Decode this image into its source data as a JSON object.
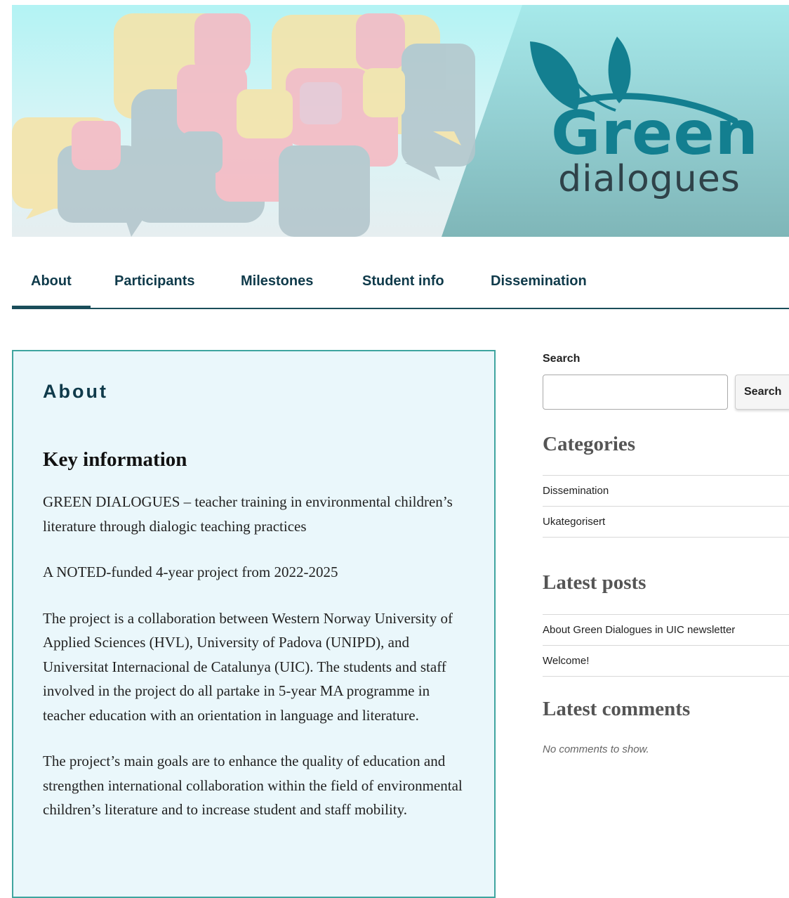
{
  "banner": {
    "wordmark_line1": "Green",
    "wordmark_line2": "dialogues",
    "colors": {
      "teal": "#137f90",
      "dark": "#2f4249",
      "sky": "#b6f2f4"
    }
  },
  "nav": {
    "items": [
      {
        "label": "About",
        "active": true
      },
      {
        "label": "Participants"
      },
      {
        "label": "Milestones"
      },
      {
        "label": "Student info"
      },
      {
        "label": "Dissemination"
      }
    ]
  },
  "main": {
    "page_title": "About",
    "section_heading": "Key information",
    "paragraphs": [
      "GREEN DIALOGUES – teacher training in environmental children’s literature through dialogic teaching practices",
      "A NOTED-funded 4-year project from 2022-2025",
      "The project is a collaboration between Western Norway University of Applied Sciences (HVL), University of Padova (UNIPD), and Universitat Internacional de Catalunya (UIC). The students and staff involved in the project do all partake in 5-year MA programme in teacher education with an orientation in language and literature.",
      "The project’s main goals are to enhance the quality of education and strengthen international collaboration within the field of environmental children’s literature and to increase student and staff mobility."
    ]
  },
  "sidebar": {
    "search": {
      "label": "Search",
      "button_label": "Search",
      "value": "",
      "placeholder": ""
    },
    "categories": {
      "title": "Categories",
      "items": [
        "Dissemination",
        "Ukategorisert"
      ]
    },
    "latest_posts": {
      "title": "Latest posts",
      "items": [
        "About Green Dialogues in UIC newsletter",
        "Welcome!"
      ]
    },
    "latest_comments": {
      "title": "Latest comments",
      "empty_text": "No comments to show."
    }
  }
}
